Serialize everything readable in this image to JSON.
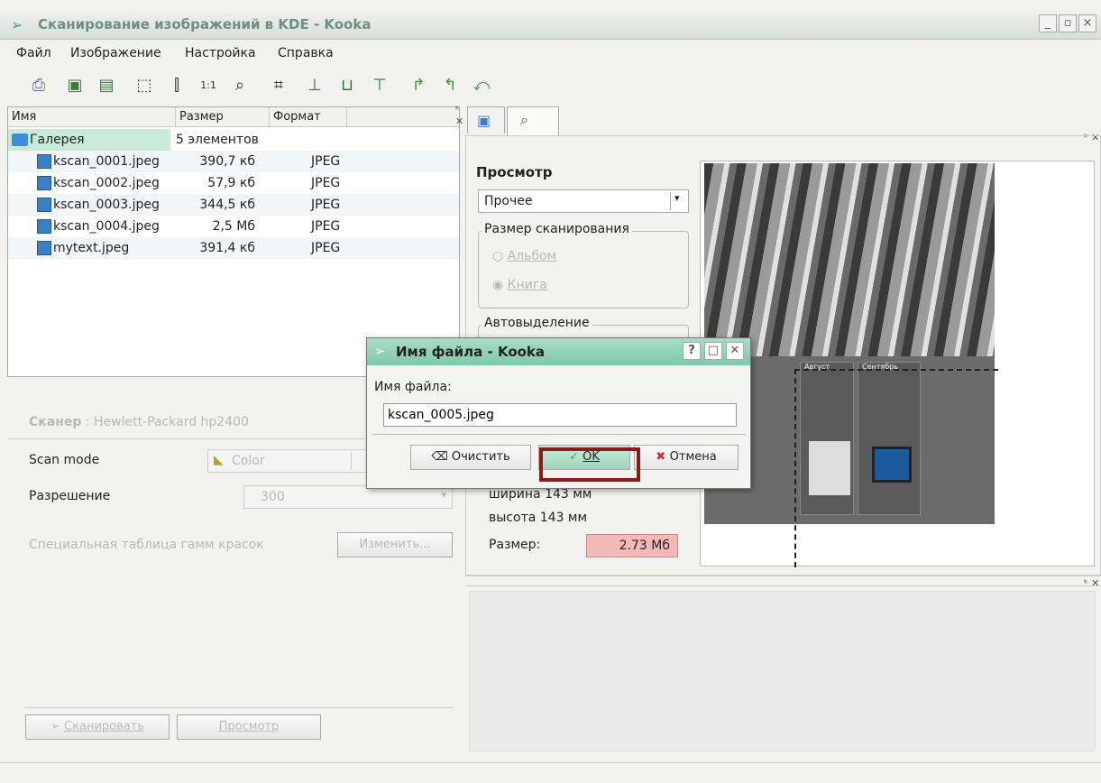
{
  "window": {
    "title": "Сканирование изображений в KDE - Kooka",
    "min": "_",
    "max": "▫",
    "close": "×"
  },
  "menu": [
    {
      "label": "Файл"
    },
    {
      "label": "Изображение"
    },
    {
      "label": "Настройка"
    },
    {
      "label": "Справка"
    }
  ],
  "toolbar_icons": [
    "printer-icon",
    "scan-image-icon",
    "scan-copy-icon",
    "fit-width-icon",
    "fit-height-icon",
    "zoom-1to1-icon",
    "zoom-icon",
    "crop-icon",
    "mirror-vertical-icon",
    "mirror-horizontal-icon",
    "mirror-both-icon",
    "rotate-right-icon",
    "rotate-left-icon",
    "rotate-180-icon"
  ],
  "gallery": {
    "headers": {
      "name": "Имя",
      "size": "Размер",
      "format": "Формат"
    },
    "root": {
      "name": "Галерея",
      "size": "5 элементов"
    },
    "files": [
      {
        "name": "kscan_0001.jpeg",
        "size": "390,7 кб",
        "format": "JPEG"
      },
      {
        "name": "kscan_0002.jpeg",
        "size": "57,9 кб",
        "format": "JPEG"
      },
      {
        "name": "kscan_0003.jpeg",
        "size": "344,5 кб",
        "format": "JPEG"
      },
      {
        "name": "kscan_0004.jpeg",
        "size": "2,5 Мб",
        "format": "JPEG"
      },
      {
        "name": "mytext.jpeg",
        "size": "391,4 кб",
        "format": "JPEG"
      }
    ]
  },
  "scanner": {
    "label": "Сканер",
    "device": " : Hewlett-Packard hp2400",
    "mode_label": "Scan mode",
    "mode_value": "Color",
    "resolution_label": "Разрешение",
    "resolution_value": "300",
    "gamma_label": "Специальная таблица гамм красок",
    "gamma_button": "Изменить...",
    "scan_button": "Сканировать",
    "preview_button": "Просмотр"
  },
  "preview_panel": {
    "title": "Просмотр",
    "size_select": "Прочее",
    "scan_size_group": "Размер сканирования",
    "radio_album": "Альбом",
    "radio_book": "Книга",
    "autoselect_group": "Автовыделение",
    "width_text": "ширина 143 мм",
    "height_text": "высота 143 мм",
    "size_label": "Размер:",
    "size_value": "2.73 Мб"
  },
  "preview_image": {
    "month1": "Август",
    "month2": "Сентябрь"
  },
  "dialog": {
    "title": "Имя файла - Kooka",
    "help": "?",
    "max": "□",
    "close": "✕",
    "label": "Имя файла:",
    "value": "kscan_0005.jpeg",
    "clear_button": "Очистить",
    "ok_button": "OK",
    "cancel_button": "Отмена"
  },
  "colors": {
    "accent": "#7fc8aa",
    "highlight_box": "#8b1a1a",
    "size_badge": "#f5b8b8"
  }
}
